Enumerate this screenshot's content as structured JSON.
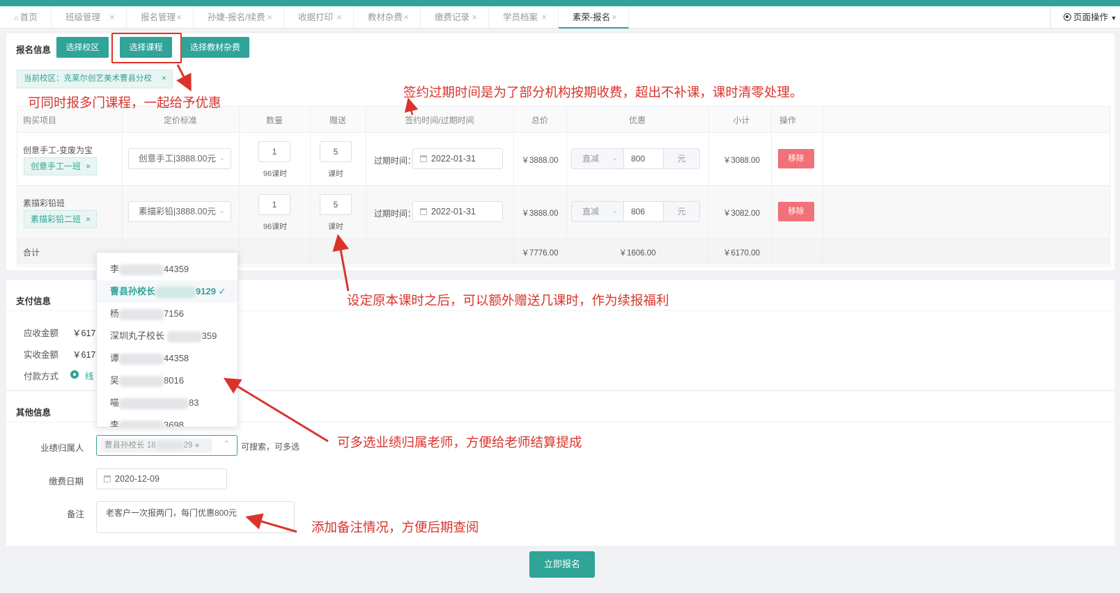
{
  "tabs": [
    {
      "label": "首页",
      "icon": "home-icon"
    },
    {
      "label": "班级管理"
    },
    {
      "label": "报名管理"
    },
    {
      "label": "孙婕-报名/续费"
    },
    {
      "label": "收据打印"
    },
    {
      "label": "教材杂费"
    },
    {
      "label": "缴费记录"
    },
    {
      "label": "学员档案"
    },
    {
      "label": "素荣-报名",
      "active": true
    }
  ],
  "page_ops": "页面操作",
  "enroll": {
    "title": "报名信息",
    "btn_campus": "选择校区",
    "btn_course": "选择课程",
    "btn_material": "选择教材杂费",
    "campus_tag": "当前校区：克莱尔创艺美术曹县分校",
    "headers": [
      "购买项目",
      "定价标准",
      "数量",
      "赠送",
      "签约时间/过期时间",
      "总价",
      "优惠",
      "小计",
      "操作"
    ],
    "rows": [
      {
        "item": "创意手工-变废为宝",
        "class_tag": "创意手工一班",
        "pricing": "创意手工|3888.00元",
        "qty": "1",
        "qty_sub": "96课时",
        "gift": "5",
        "gift_sub": "课时",
        "expire_label": "过期时间：",
        "expire": "2022-01-31",
        "total": "￥3888.00",
        "disc_type": "直减",
        "disc_value": "800",
        "disc_unit": "元",
        "subtotal": "￥3088.00",
        "action": "移除"
      },
      {
        "item": "素描彩铅班",
        "class_tag": "素描彩铅二班",
        "pricing": "素描彩铅|3888.00元",
        "qty": "1",
        "qty_sub": "96课时",
        "gift": "5",
        "gift_sub": "课时",
        "expire_label": "过期时间：",
        "expire": "2022-01-31",
        "total": "￥3888.00",
        "disc_type": "直减",
        "disc_value": "806",
        "disc_unit": "元",
        "subtotal": "￥3082.00",
        "action": "移除"
      }
    ],
    "sum_label": "合计",
    "sum_total": "￥7776.00",
    "sum_discount": "￥1606.00",
    "sum_subtotal": "￥6170.00"
  },
  "payment": {
    "title": "支付信息",
    "due_label": "应收金额",
    "due": "￥617(",
    "paid_label": "实收金额",
    "paid": "￥617(",
    "method_label": "付款方式",
    "method": "线"
  },
  "other": {
    "title": "其他信息",
    "owner_label": "业绩归属人",
    "owner_tag": "曹县孙校长 18",
    "owner_tag_tail": "29",
    "owner_hint": "可搜索，可多选",
    "date_label": "缴费日期",
    "date": "2020-12-09",
    "note_label": "备注",
    "note": "老客户一次报两门，每门优惠800元"
  },
  "dropdown": [
    {
      "pre": "李",
      "post": "44359"
    },
    {
      "pre": "曹县孙校长",
      "post": "9129",
      "selected": true
    },
    {
      "pre": "杨",
      "post": "7156"
    },
    {
      "pre": "深圳丸子校长",
      "post": "359"
    },
    {
      "pre": "谭",
      "post": "44358"
    },
    {
      "pre": "吴",
      "post": "8016"
    },
    {
      "pre": "喵",
      "post": "83"
    },
    {
      "pre": "李",
      "post": "3698"
    }
  ],
  "submit": "立即报名",
  "annotations": {
    "multi_course": "可同时报多门课程，一起给予优惠",
    "expire": "签约过期时间是为了部分机构按期收费，超出不补课，课时清零处理。",
    "gift": "设定原本课时之后，可以额外赠送几课时，作为续报福利",
    "teachers": "可多选业绩归属老师，方便给老师结算提成",
    "note": "添加备注情况，方便后期查阅"
  },
  "colors": {
    "primary": "#2fa497",
    "danger": "#f07177",
    "annotation": "#d9342b"
  }
}
